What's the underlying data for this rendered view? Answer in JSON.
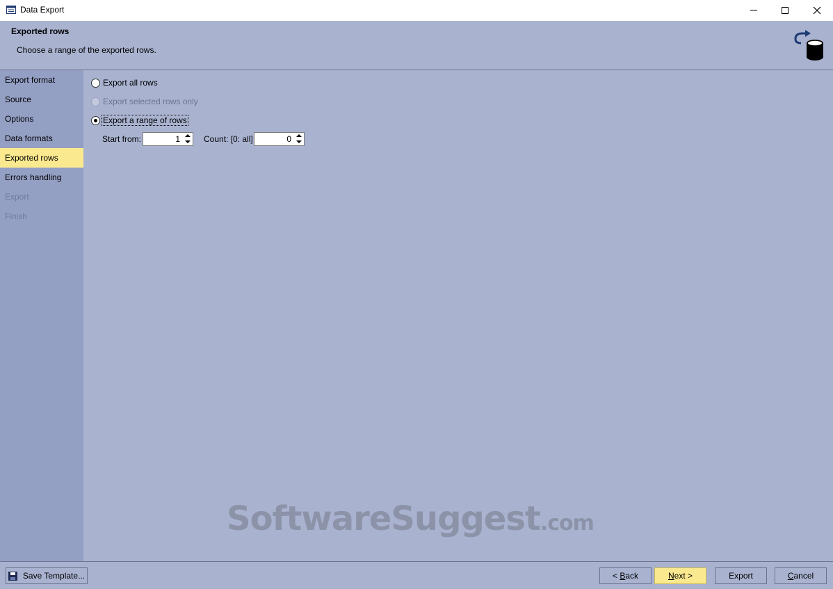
{
  "window": {
    "title": "Data Export"
  },
  "header": {
    "title": "Exported rows",
    "subtitle": "Choose a range of the exported rows."
  },
  "sidebar": {
    "items": [
      {
        "label": "Export format",
        "state": "normal"
      },
      {
        "label": "Source",
        "state": "normal"
      },
      {
        "label": "Options",
        "state": "normal"
      },
      {
        "label": "Data formats",
        "state": "normal"
      },
      {
        "label": "Exported rows",
        "state": "active"
      },
      {
        "label": "Errors handling",
        "state": "normal"
      },
      {
        "label": "Export",
        "state": "disabled"
      },
      {
        "label": "Finish",
        "state": "disabled"
      }
    ]
  },
  "options": {
    "export_all": {
      "label": "Export all rows",
      "checked": false,
      "enabled": true
    },
    "export_selected": {
      "label": "Export selected rows only",
      "checked": false,
      "enabled": false
    },
    "export_range": {
      "label": "Export a range of rows",
      "checked": true,
      "enabled": true
    }
  },
  "range": {
    "start_label": "Start from:",
    "start_value": "1",
    "count_label": "Count: [0: all]",
    "count_value": "0"
  },
  "watermark": {
    "text": "SoftwareSuggest",
    "tld": ".com"
  },
  "footer": {
    "save_template": "Save Template...",
    "back_prefix": "< ",
    "back_key": "B",
    "back_rest": "ack",
    "next_key": "N",
    "next_rest": "ext >",
    "export_label": "Export",
    "cancel_key": "C",
    "cancel_rest": "ancel"
  },
  "colors": {
    "background": "#a9b3d0",
    "sidebar": "#949fc4",
    "active_highlight": "#fbe98f"
  }
}
